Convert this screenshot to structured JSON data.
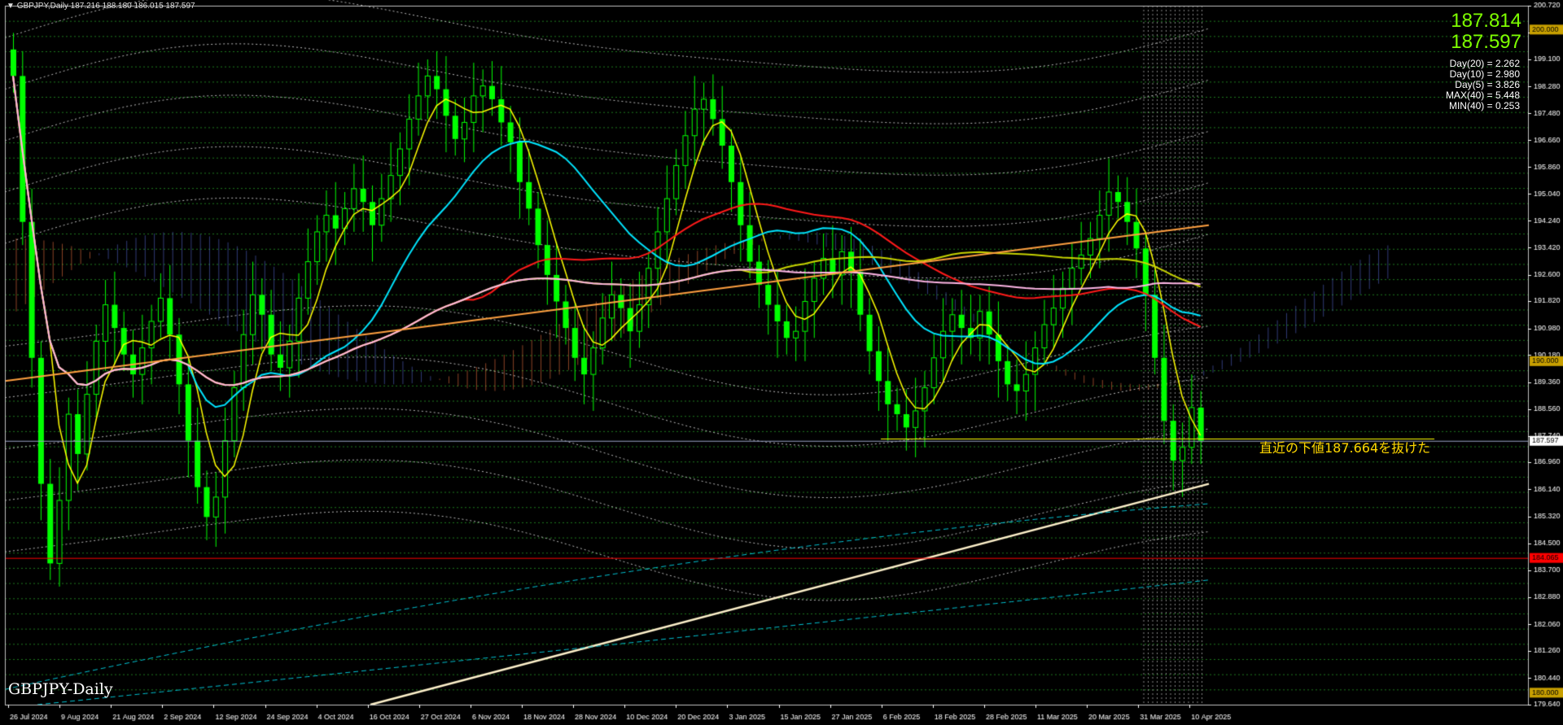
{
  "header": {
    "symbol": "GBPJPY,Daily",
    "ohlc": "187.216 188.180 186.015 187.597"
  },
  "bid_ask": {
    "ask": "187.814",
    "bid": "187.597"
  },
  "range_stats": [
    "Day(20) = 2.262",
    "Day(10) = 2.980",
    "Day(5) = 3.826",
    "MAX(40) = 5.448",
    "MIN(40) = 0.253"
  ],
  "symbol_label": "GBPJPY-Daily",
  "annotation": "直近の下値187.664を抜けた",
  "colors": {
    "background": "#000000",
    "candle": "#00ff00",
    "ma_fast": "#ffff00",
    "ma_mid": "#00e5ff",
    "ma_red": "#ff1a1a",
    "ma_orange": "#ffa040",
    "ma_pink": "#ffb6e6",
    "ma_olive": "#c8d400",
    "cloud_blue": "#5a6bd8",
    "cloud_red": "#ff7a45",
    "price_line": "#ffffff",
    "support_red": "#ff0000"
  },
  "chart_data": {
    "type": "candlestick",
    "title": "",
    "ylim": [
      179.64,
      200.72
    ],
    "y_ticks": [
      "200.720",
      "199.910",
      "199.100",
      "198.280",
      "197.480",
      "196.660",
      "195.860",
      "195.040",
      "194.240",
      "193.420",
      "192.600",
      "191.820",
      "190.980",
      "190.180",
      "189.360",
      "188.560",
      "187.740",
      "186.960",
      "186.140",
      "185.320",
      "184.500",
      "183.700",
      "182.880",
      "182.060",
      "181.260",
      "180.440",
      "179.640"
    ],
    "x_labels": [
      "26 Jul 2024",
      "9 Aug 2024",
      "21 Aug 2024",
      "2 Sep 2024",
      "12 Sep 2024",
      "24 Sep 2024",
      "4 Oct 2024",
      "16 Oct 2024",
      "27 Oct 2024",
      "6 Nov 2024",
      "18 Nov 2024",
      "28 Nov 2024",
      "10 Dec 2024",
      "20 Dec 2024",
      "3 Jan 2025",
      "15 Jan 2025",
      "27 Jan 2025",
      "6 Feb 2025",
      "18 Feb 2025",
      "28 Feb 2025",
      "11 Mar 2025",
      "20 Mar 2025",
      "31 Mar 2025",
      "10 Apr 2025"
    ],
    "price_tags": [
      {
        "value": 200.0,
        "text": "200.000",
        "color": "#c8a000"
      },
      {
        "value": 190.0,
        "text": "190.000",
        "color": "#c8a000"
      },
      {
        "value": 187.597,
        "text": "187.597",
        "color": "#ffffff"
      },
      {
        "value": 184.065,
        "text": "184.065",
        "color": "#ff0000"
      },
      {
        "value": 180.0,
        "text": "180.000",
        "color": "#c8a000"
      }
    ],
    "support_level": 187.664,
    "current_price": 187.597,
    "red_level": 184.065,
    "closes": [
      198.6,
      194.2,
      190.1,
      186.3,
      183.9,
      185.8,
      188.4,
      187.2,
      189.0,
      190.6,
      191.7,
      191.0,
      190.2,
      189.6,
      190.4,
      191.2,
      191.9,
      190.8,
      189.3,
      187.6,
      186.2,
      185.3,
      185.9,
      187.6,
      189.2,
      190.8,
      192.0,
      191.4,
      190.2,
      189.8,
      190.6,
      191.9,
      193.0,
      193.9,
      194.4,
      194.0,
      194.6,
      195.2,
      194.8,
      194.1,
      194.9,
      195.6,
      196.4,
      197.3,
      198.0,
      198.6,
      198.2,
      197.4,
      196.7,
      197.2,
      198.0,
      198.3,
      197.9,
      197.2,
      196.6,
      195.4,
      194.6,
      193.5,
      192.6,
      191.8,
      191.0,
      190.1,
      189.6,
      190.4,
      191.3,
      192.0,
      191.6,
      190.9,
      191.7,
      192.8,
      193.9,
      194.9,
      195.9,
      196.8,
      197.6,
      197.9,
      197.3,
      196.5,
      195.4,
      194.1,
      193.0,
      192.3,
      191.7,
      191.2,
      190.7,
      190.9,
      191.8,
      192.5,
      193.1,
      192.6,
      193.3,
      192.7,
      191.4,
      190.3,
      189.4,
      188.7,
      188.4,
      188.0,
      188.5,
      189.2,
      190.1,
      190.9,
      191.4,
      191.0,
      190.7,
      191.5,
      190.8,
      190.0,
      189.3,
      189.1,
      189.6,
      190.4,
      191.1,
      191.6,
      192.2,
      192.8,
      193.2,
      193.7,
      194.4,
      195.1,
      194.8,
      194.2,
      193.4,
      192.0,
      190.1,
      188.2,
      187.0,
      187.4,
      188.6,
      187.6
    ],
    "overlays": [
      {
        "name": "",
        "color": "#ffff00",
        "points": [
          [
            0,
            196.8
          ],
          [
            10,
            187.0
          ],
          [
            20,
            191.0
          ],
          [
            30,
            190.0
          ],
          [
            40,
            192.6
          ],
          [
            60,
            196.3
          ],
          [
            80,
            189.9
          ],
          [
            100,
            197.4
          ],
          [
            120,
            193.0
          ],
          [
            140,
            189.0
          ],
          [
            160,
            193.2
          ],
          [
            170,
            194.6
          ],
          [
            180,
            189.2
          ]
        ]
      }
    ]
  }
}
